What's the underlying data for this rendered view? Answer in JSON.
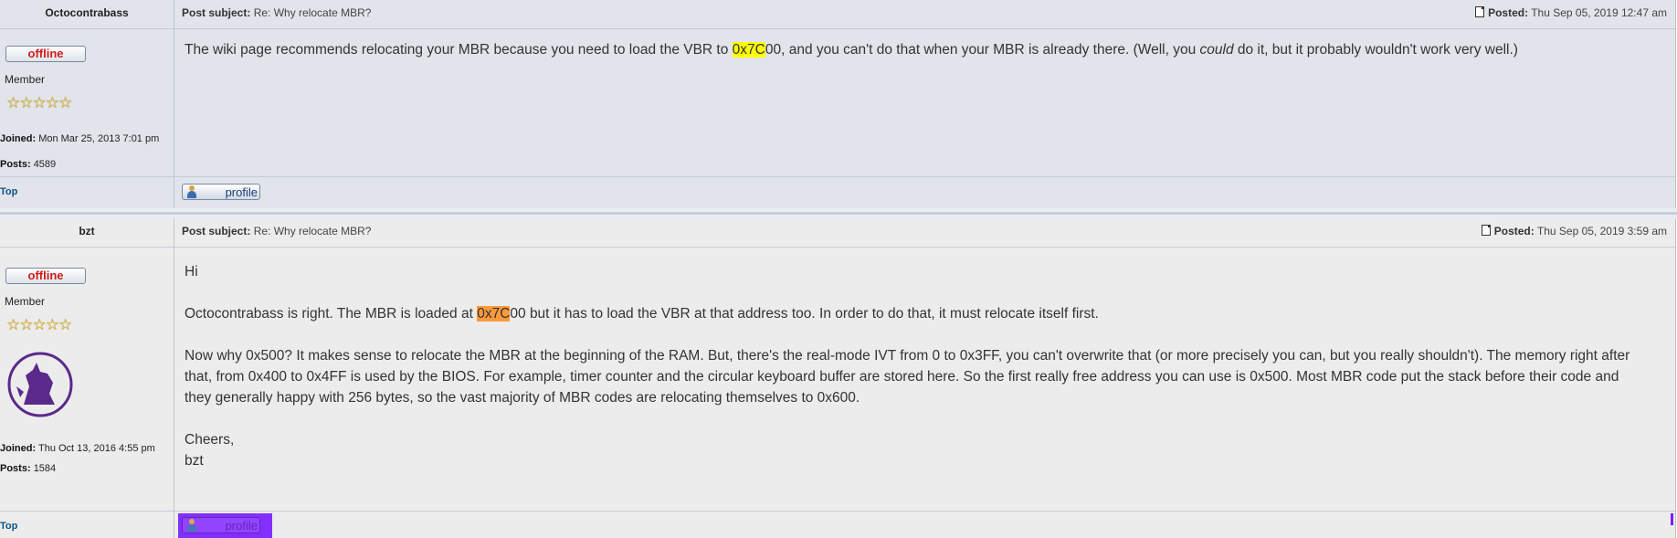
{
  "posts": [
    {
      "author": "Octocontrabass",
      "status": "offline",
      "rank": "Member",
      "stars": "☆☆☆☆☆",
      "joined_label": "Joined:",
      "joined_value": "Mon Mar 25, 2013 7:01 pm",
      "posts_label": "Posts:",
      "posts_value": "4589",
      "subject_label": "Post subject:",
      "subject_value": "Re: Why relocate MBR?",
      "posted_label": "Posted:",
      "posted_value": "Thu Sep 05, 2019 12:47 am",
      "body": {
        "t1": "The wiki page recommends relocating your MBR because you need to load the VBR to ",
        "hl": "0x7C",
        "t2": "00, and you can't do that when your MBR is already there. (Well, you ",
        "em": "could",
        "t3": " do it, but it probably wouldn't work very well.)"
      },
      "top_link": "Top",
      "profile_button": "profile"
    },
    {
      "author": "bzt",
      "status": "offline",
      "rank": "Member",
      "stars": "☆☆☆☆☆",
      "joined_label": "Joined:",
      "joined_value": "Thu Oct 13, 2016 4:55 pm",
      "posts_label": "Posts:",
      "posts_value": "1584",
      "subject_label": "Post subject:",
      "subject_value": "Re: Why relocate MBR?",
      "posted_label": "Posted:",
      "posted_value": "Thu Sep 05, 2019 3:59 am",
      "body": {
        "p1": "Hi",
        "p2a": "Octocontrabass is right. The MBR is loaded at ",
        "p2hl": "0x7C",
        "p2b": "00 but it has to load the VBR at that address too. In order to do that, it must relocate itself first.",
        "p3": "Now why 0x500? It makes sense to relocate the MBR at the beginning of the RAM. But, there's the real-mode IVT from 0 to 0x3FF, you can't overwrite that (or more precisely you can, but you really shouldn't). The memory right after that, from 0x400 to 0x4FF is used by the BIOS. For example, timer counter and the circular keyboard buffer are stored here. So the first really free address you can use is 0x500. Most MBR code put the stack before their code and they generally happy with 256 bytes, so the vast majority of MBR codes are relocating themselves to 0x600.",
        "p4a": "Cheers,",
        "p4b": "bzt"
      },
      "top_link": "Top",
      "profile_button": "profile"
    }
  ],
  "colors": {
    "post1_bg": "#e1e4ea",
    "post2_bg": "#ececec",
    "highlight_yellow": "#ffff00",
    "highlight_orange": "#ff9a3c",
    "selection": "#7b1fff",
    "offline_text": "#d11a1a",
    "link": "#105289"
  }
}
